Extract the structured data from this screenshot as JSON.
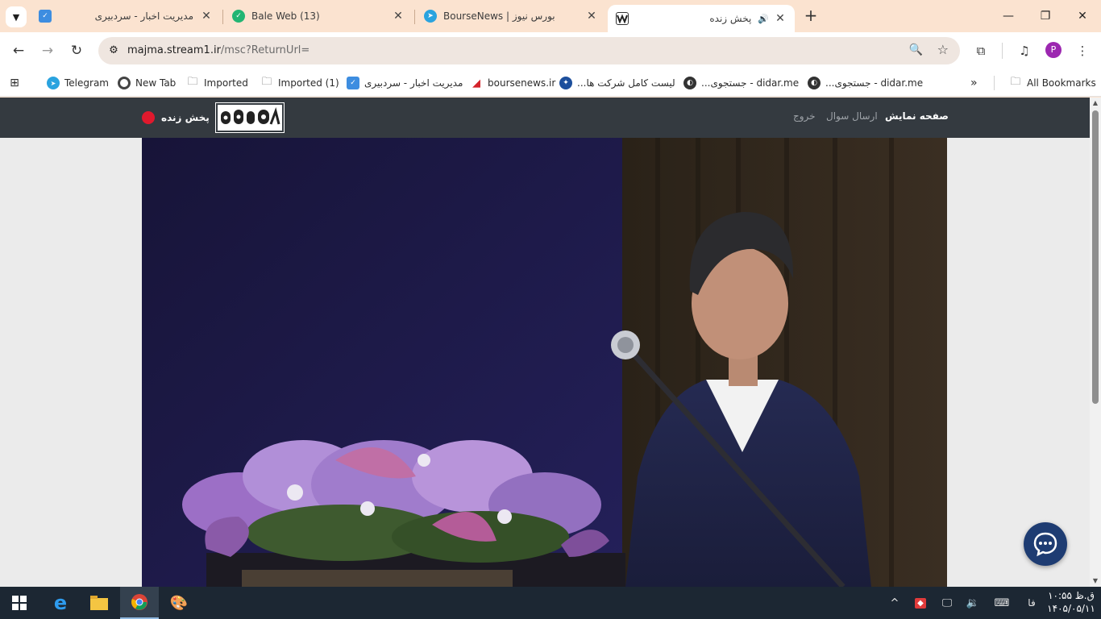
{
  "browser": {
    "tabs": [
      {
        "title": "مدیریت اخبار - سردبیری",
        "favicon": "checklist-favicon",
        "active": false
      },
      {
        "title": "Bale Web (13)",
        "favicon": "bale-favicon",
        "active": false
      },
      {
        "title": "بورس نیوز | BourseNews",
        "favicon": "telegram-favicon",
        "active": false
      },
      {
        "title": "پخش زنده",
        "favicon": "majma-favicon",
        "active": true,
        "audio": true
      }
    ],
    "new_tab_symbol": "+",
    "window_controls": {
      "minimize": "—",
      "maximize": "❐",
      "close": "✕"
    }
  },
  "toolbar": {
    "url_host": "majma.stream1.ir",
    "url_path": "/msc?ReturnUrl="
  },
  "bookmarks": {
    "items": [
      {
        "label": "Telegram",
        "icon": "telegram-icon"
      },
      {
        "label": "New Tab",
        "icon": "chrome-icon"
      },
      {
        "label": "Imported",
        "icon": "folder-icon"
      },
      {
        "label": "Imported (1)",
        "icon": "folder-icon"
      },
      {
        "label": "مدیریت اخبار - سردبیری",
        "icon": "checklist-icon"
      },
      {
        "label": "boursenews.ir",
        "icon": "boursenews-icon"
      },
      {
        "label": "لیست کامل شرکت ها...",
        "icon": "company-icon"
      },
      {
        "label": "didar.me - جستجوی...",
        "icon": "globe-icon"
      },
      {
        "label": "didar.me - جستجوی...",
        "icon": "globe-icon"
      }
    ],
    "overflow_symbol": "»",
    "all_bookmarks": "All Bookmarks"
  },
  "site": {
    "nav": {
      "home": "صفحه نمایش",
      "ask": "ارسال سوال",
      "logout": "خروج"
    },
    "live_label": "پخش زنده",
    "colors": {
      "nav_bg": "#343a40",
      "live_dot": "#e0192d",
      "chat_fab": "#1e3c72"
    }
  },
  "taskbar": {
    "apps": [
      "windows-start-icon",
      "edge-icon",
      "file-explorer-icon",
      "chrome-icon",
      "paint-icon"
    ],
    "tray_language": "فا",
    "clock_time": "ق.ظ ۱۰:۵۵",
    "clock_date": "۱۴۰۵/۰۵/۱۱"
  }
}
